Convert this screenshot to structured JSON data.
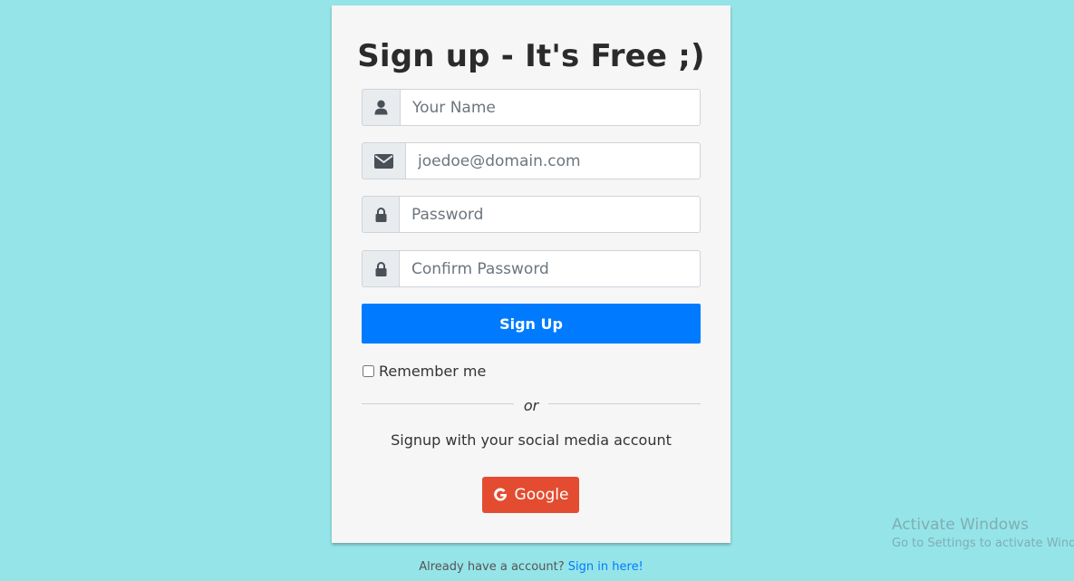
{
  "form": {
    "title": "Sign up - It's Free ;)",
    "fields": [
      {
        "icon": "user-icon",
        "placeholder": "Your Name",
        "type": "text"
      },
      {
        "icon": "envelope-icon",
        "placeholder": "joedoe@domain.com",
        "type": "email"
      },
      {
        "icon": "lock-icon",
        "placeholder": "Password",
        "type": "password"
      },
      {
        "icon": "lock-icon",
        "placeholder": "Confirm Password",
        "type": "password"
      }
    ],
    "submit_label": "Sign Up",
    "remember_label": "Remember me",
    "remember_checked": false,
    "divider_text": "or",
    "social_text": "Signup with your social media account",
    "google_label": "Google"
  },
  "footer": {
    "text": "Already have a account?",
    "link_label": "Sign in here!"
  },
  "watermark": {
    "title": "Activate Windows",
    "subtitle": "Go to Settings to activate Windows."
  },
  "colors": {
    "background": "#95e4e8",
    "card": "#f6f6f6",
    "primary": "#007bff",
    "google": "#e34c30"
  }
}
